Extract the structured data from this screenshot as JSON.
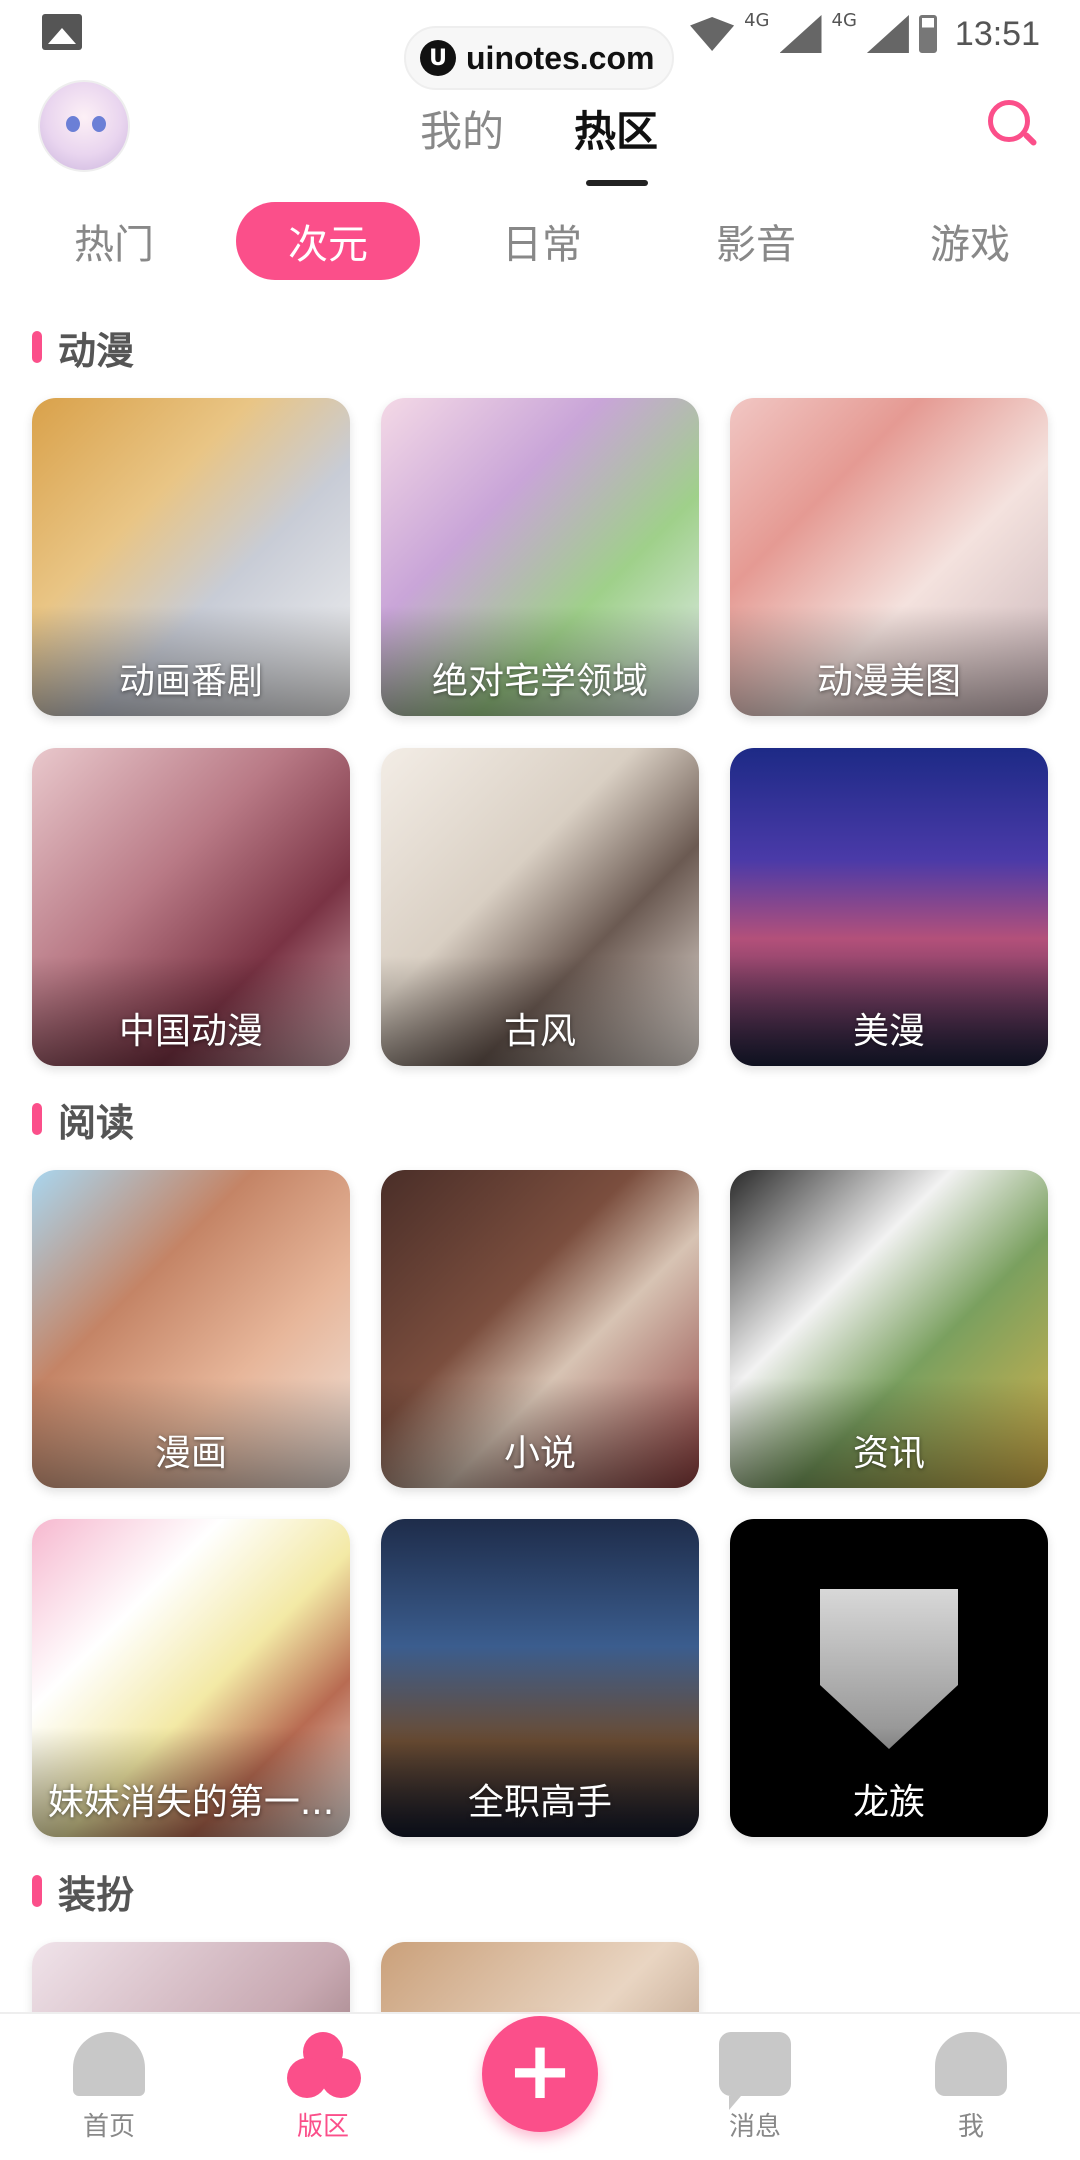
{
  "status_bar": {
    "network_left": "4G",
    "network_right": "4G",
    "time": "13:51"
  },
  "watermark": {
    "logo": "U",
    "text": "uinotes.com"
  },
  "top_nav": {
    "tabs": [
      {
        "label": "我的"
      },
      {
        "label": "热区"
      }
    ],
    "active_tab": "热区"
  },
  "categories": [
    {
      "label": "热门"
    },
    {
      "label": "次元"
    },
    {
      "label": "日常"
    },
    {
      "label": "影音"
    },
    {
      "label": "游戏"
    }
  ],
  "active_category": "次元",
  "sections": [
    {
      "title": "动漫",
      "cards": [
        {
          "label": "动画番剧"
        },
        {
          "label": "绝对宅学领域"
        },
        {
          "label": "动漫美图"
        },
        {
          "label": "中国动漫"
        },
        {
          "label": "古风"
        },
        {
          "label": "美漫"
        }
      ]
    },
    {
      "title": "阅读",
      "cards": [
        {
          "label": "漫画"
        },
        {
          "label": "小说"
        },
        {
          "label": "资讯"
        },
        {
          "label": "妹妹消失的第一..."
        },
        {
          "label": "全职高手"
        },
        {
          "label": "龙族"
        }
      ]
    },
    {
      "title": "装扮",
      "cards": []
    }
  ],
  "bottom_nav": {
    "items": [
      {
        "label": "首页",
        "icon": "home-icon"
      },
      {
        "label": "版区",
        "icon": "forum-icon"
      },
      {
        "label": "",
        "icon": "plus-icon"
      },
      {
        "label": "消息",
        "icon": "message-icon"
      },
      {
        "label": "我",
        "icon": "profile-icon"
      }
    ],
    "active": "版区"
  },
  "colors": {
    "accent": "#fb4f8a",
    "inactive": "#888888"
  }
}
